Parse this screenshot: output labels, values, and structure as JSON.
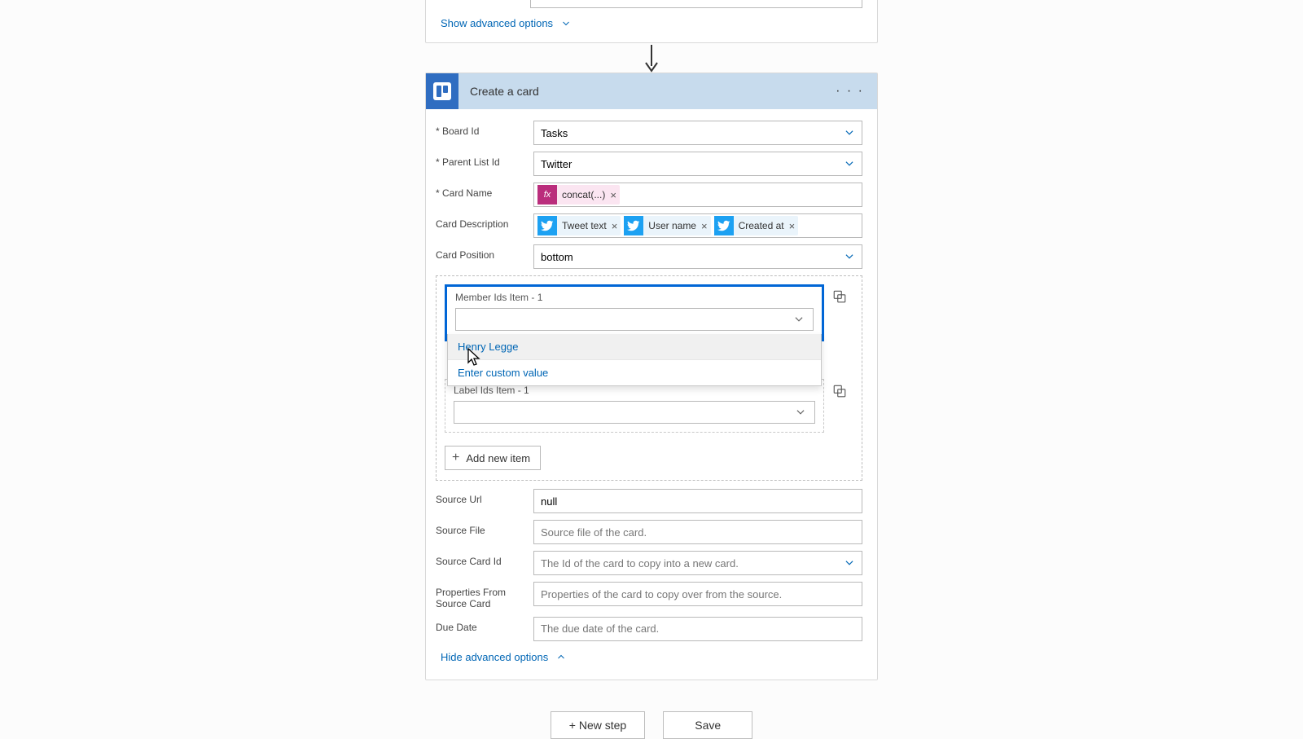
{
  "stub": {
    "adv_label": "Show advanced options"
  },
  "action": {
    "title": "Create a card",
    "fields": {
      "board_id": {
        "label": "* Board Id",
        "value": "Tasks"
      },
      "parent_list_id": {
        "label": "* Parent List Id",
        "value": "Twitter"
      },
      "card_name": {
        "label": "* Card Name"
      },
      "card_desc": {
        "label": "Card Description"
      },
      "card_pos": {
        "label": "Card Position",
        "value": "bottom"
      },
      "source_url": {
        "label": "Source Url",
        "value": "null"
      },
      "source_file": {
        "label": "Source File",
        "placeholder": "Source file of the card."
      },
      "source_card_id": {
        "label": "Source Card Id",
        "placeholder": "The Id of the card to copy into a new card."
      },
      "props_from_src": {
        "label": "Properties From Source Card",
        "placeholder": "Properties of the card to copy over from the source."
      },
      "due_date": {
        "label": "Due Date",
        "placeholder": "The due date of the card."
      }
    },
    "tokens": {
      "fx_concat": "concat(...)",
      "tweet_text": "Tweet text",
      "user_name": "User name",
      "created_at": "Created at"
    },
    "dynamic": {
      "member_label": "Member Ids Item - 1",
      "label_label": "Label Ids Item - 1",
      "add_item": "Add new item",
      "dropdown": {
        "option1": "Henry Legge",
        "option2": "Enter custom value"
      }
    },
    "hide_adv": "Hide advanced options"
  },
  "footer": {
    "new_step": "+  New step",
    "save": "Save"
  }
}
